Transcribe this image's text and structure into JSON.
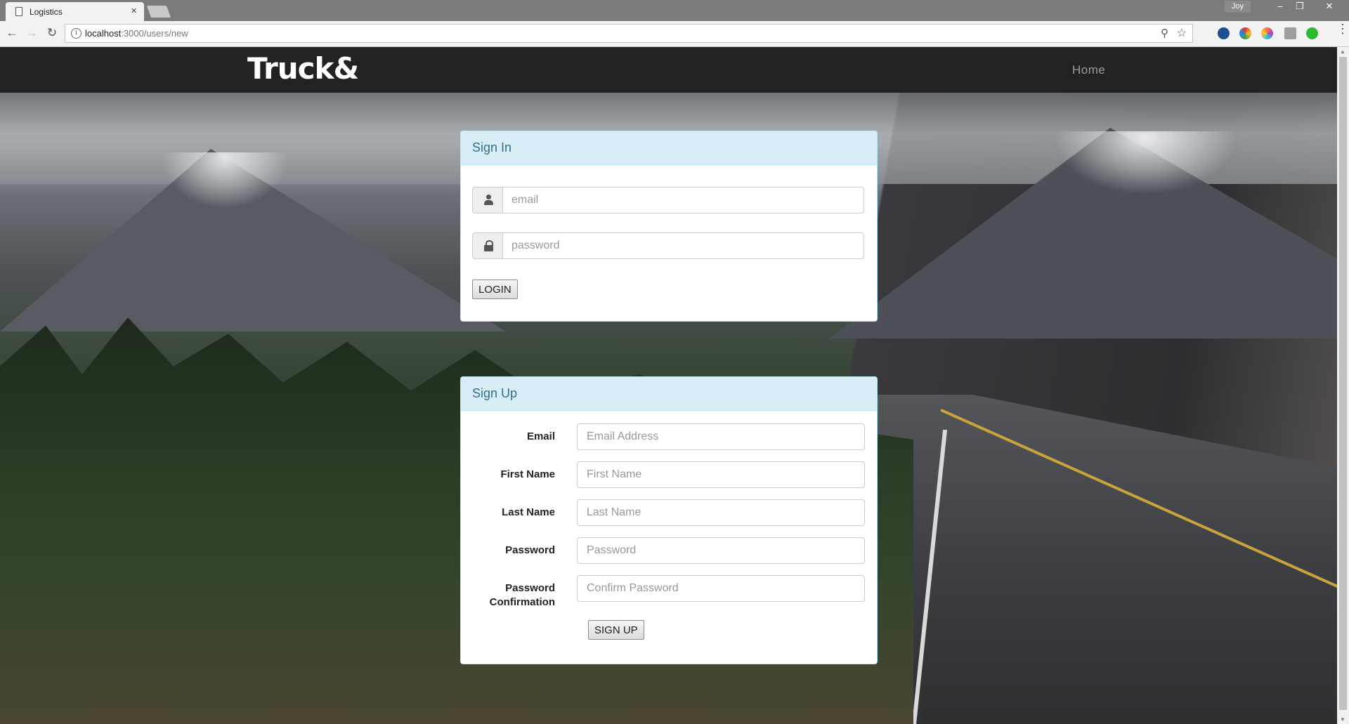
{
  "browser": {
    "tab_title": "Logistics",
    "tab_close": "×",
    "profile_name": "Joy",
    "url_host": "localhost",
    "url_path": ":3000/users/new"
  },
  "navbar": {
    "brand": "Truck&",
    "home_link": "Home"
  },
  "signin": {
    "heading": "Sign In",
    "email_placeholder": "email",
    "password_placeholder": "password",
    "login_button": "LOGIN"
  },
  "signup": {
    "heading": "Sign Up",
    "fields": [
      {
        "label": "Email",
        "placeholder": "Email Address"
      },
      {
        "label": "First Name",
        "placeholder": "First Name"
      },
      {
        "label": "Last Name",
        "placeholder": "Last Name"
      },
      {
        "label": "Password",
        "placeholder": "Password"
      },
      {
        "label": "Password Confirmation",
        "placeholder": "Confirm Password"
      }
    ],
    "submit_button": "SIGN UP"
  },
  "colors": {
    "navbar_bg": "#222222",
    "panel_heading_bg": "#d9edf7",
    "panel_heading_text": "#31708f"
  }
}
